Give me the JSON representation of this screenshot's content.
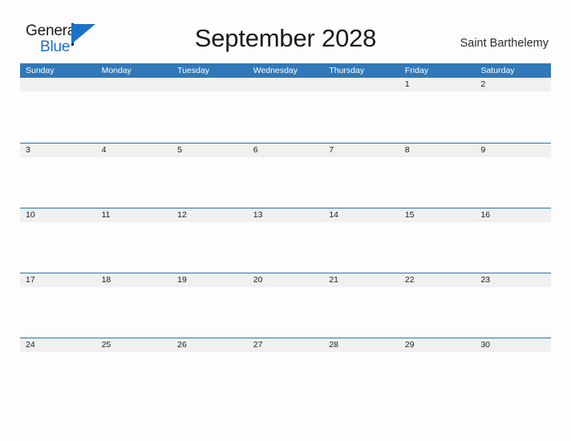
{
  "brand": {
    "name_part1": "General",
    "name_part2": "Blue",
    "flag_icon": "triangle-flag-icon",
    "primary_color": "#1a73c8",
    "text_color": "#1c1c1c"
  },
  "header": {
    "title": "September 2028",
    "location": "Saint Barthelemy"
  },
  "calendar": {
    "header_bg": "#3178b8",
    "header_text_color": "#ffffff",
    "date_band_bg": "#f0f0f0",
    "rule_color": "#2e74b5",
    "weekdays": [
      "Sunday",
      "Monday",
      "Tuesday",
      "Wednesday",
      "Thursday",
      "Friday",
      "Saturday"
    ],
    "weeks": [
      [
        "",
        "",
        "",
        "",
        "",
        "1",
        "2"
      ],
      [
        "3",
        "4",
        "5",
        "6",
        "7",
        "8",
        "9"
      ],
      [
        "10",
        "11",
        "12",
        "13",
        "14",
        "15",
        "16"
      ],
      [
        "17",
        "18",
        "19",
        "20",
        "21",
        "22",
        "23"
      ],
      [
        "24",
        "25",
        "26",
        "27",
        "28",
        "29",
        "30"
      ]
    ]
  }
}
